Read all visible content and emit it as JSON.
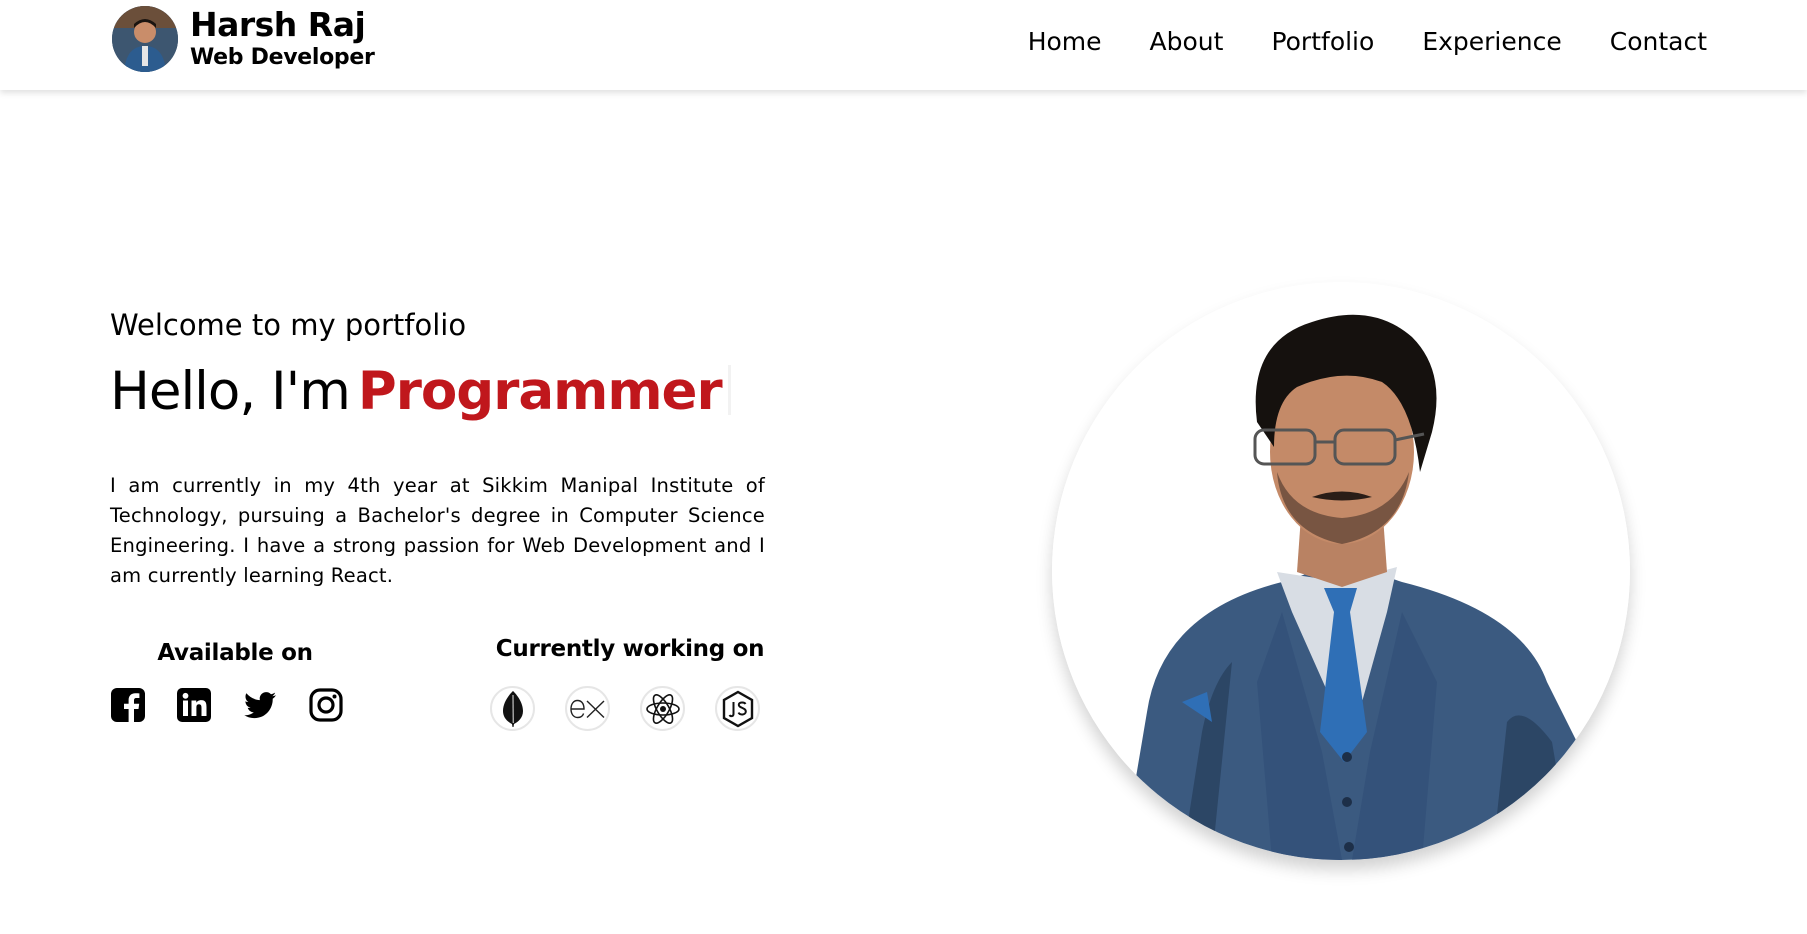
{
  "brand": {
    "name": "Harsh Raj",
    "role": "Web Developer"
  },
  "nav": {
    "items": [
      "Home",
      "About",
      "Portfolio",
      "Experience",
      "Contact"
    ]
  },
  "hero": {
    "welcome": "Welcome to my portfolio",
    "hello": "Hello, I'm",
    "role_word": "Programmer",
    "bio": "I am currently in my 4th year at Sikkim Manipal Institute of Technology, pursuing a Bachelor's degree in Computer Science Engineering. I have a strong passion for Web Development and I am currently learning React."
  },
  "available": {
    "title": "Available on",
    "icons": [
      "facebook-icon",
      "linkedin-icon",
      "twitter-icon",
      "instagram-icon"
    ]
  },
  "working": {
    "title": "Currently working on",
    "icons": [
      "mongodb-icon",
      "express-icon",
      "react-icon",
      "nodejs-icon"
    ]
  },
  "colors": {
    "accent": "#c0171c",
    "suit": "#3b5a80",
    "tie": "#2f6fb6"
  }
}
